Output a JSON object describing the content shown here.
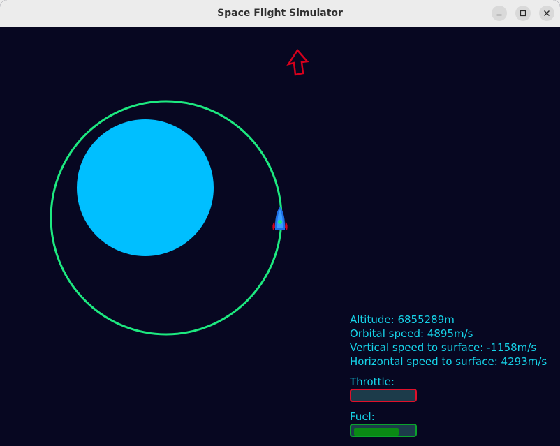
{
  "window": {
    "title": "Space Flight Simulator"
  },
  "icons": {
    "minimize": "minimize-icon",
    "maximize": "maximize-icon",
    "close": "close-icon",
    "direction_arrow": "arrow-up-outline-icon",
    "rocket": "rocket-icon"
  },
  "colors": {
    "background": "#070721",
    "planet": "#00bfff",
    "orbit": "#1de980",
    "arrow": "#d6001c",
    "hud_text": "#16d3e8",
    "throttle_border": "#e0102a",
    "fuel_border": "#0aa32c",
    "fuel_fill": "#0a8a14"
  },
  "hud": {
    "altitude": "Altitude: 6855289m",
    "orbital_speed": "Orbital speed: 4895m/s",
    "vertical_speed": "Vertical speed to surface: -1158m/s",
    "horizontal_speed": "Horizontal speed to surface: 4293m/s"
  },
  "throttle": {
    "label": "Throttle:",
    "level": 0.0
  },
  "fuel": {
    "label": "Fuel:",
    "level": 0.76
  }
}
